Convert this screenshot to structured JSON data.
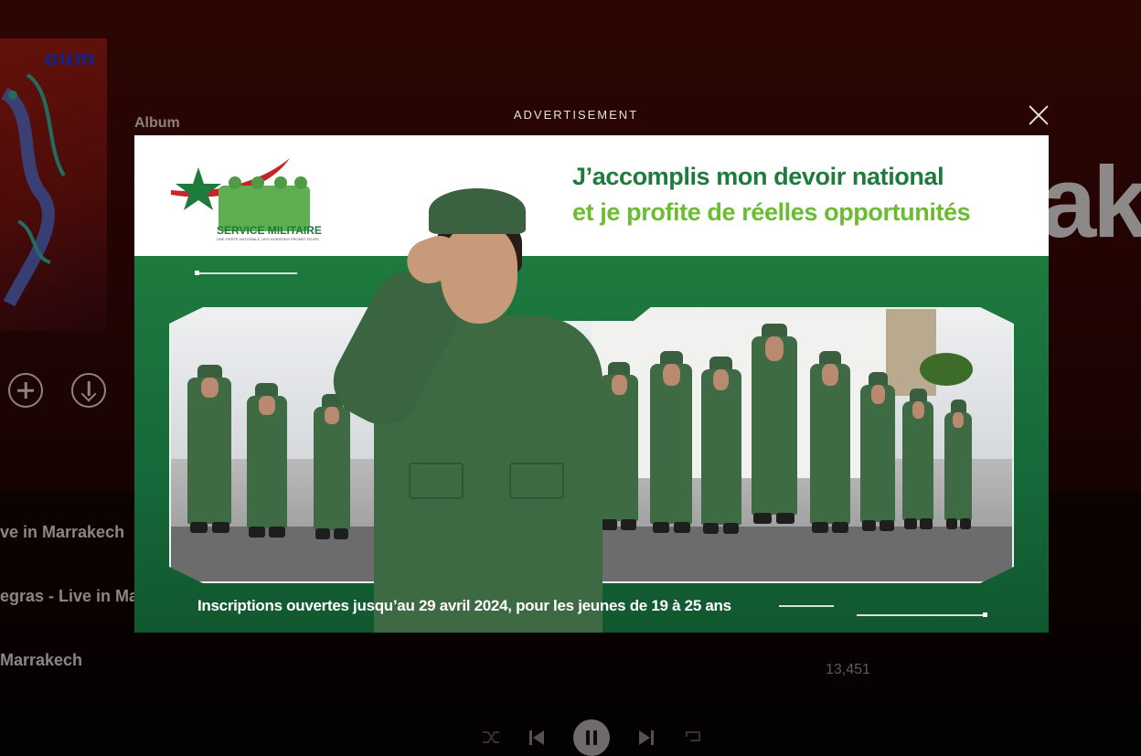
{
  "album": {
    "label": "Album",
    "cover_text": "oum",
    "title_partial": "ak"
  },
  "actions": {
    "add_icon": "plus-circle-icon",
    "download_icon": "download-circle-icon"
  },
  "tracks": [
    {
      "title": "ve in Marrakech"
    },
    {
      "title": "egras - Live in Ma"
    },
    {
      "title": "Marrakech"
    }
  ],
  "track_plays": "13,451",
  "player": {
    "shuffle_icon": "shuffle-icon",
    "prev_icon": "skip-back-icon",
    "play_state_icon": "pause-icon",
    "next_icon": "skip-forward-icon",
    "repeat_icon": "repeat-icon"
  },
  "advertisement": {
    "label": "ADVERTISEMENT",
    "close_icon": "close-icon",
    "logo_text": "SERVICE MILITAIRE",
    "logo_subtitle": "UNE FIERTÉ NATIONALE, DES HORIZONS PROMETTEURS",
    "headline_line1": "J’accomplis mon devoir national",
    "headline_line2": "et je profite de réelles opportunités",
    "footer": "Inscriptions ouvertes jusqu’au 29 avril 2024, pour les jeunes de 19 à 25 ans",
    "colors": {
      "dark_green": "#1d7b3b",
      "light_green": "#6cbc32",
      "band_green": "#15683a",
      "white": "#ffffff"
    }
  }
}
